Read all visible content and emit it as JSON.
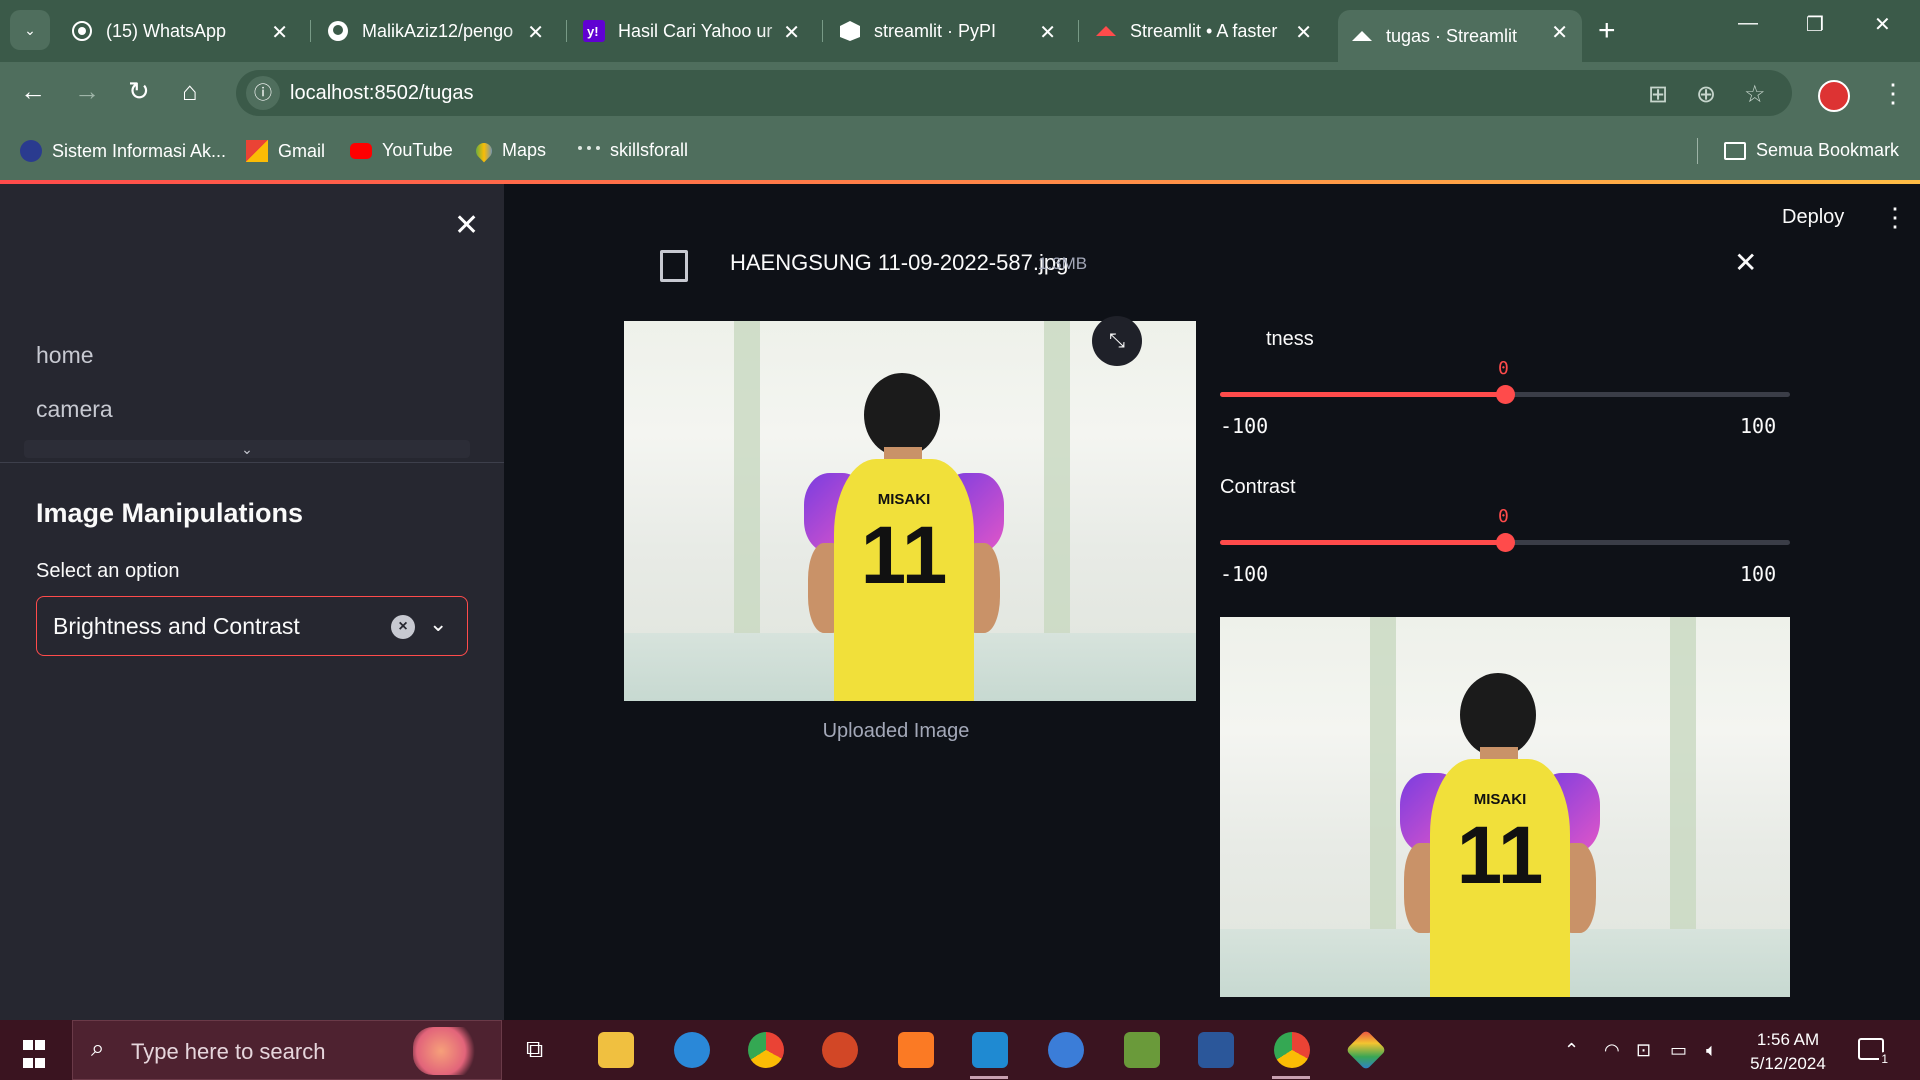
{
  "browser": {
    "tabs": [
      {
        "label": "(15) WhatsApp",
        "icon": "whatsapp-icon"
      },
      {
        "label": "MalikAziz12/pengo",
        "icon": "github-icon"
      },
      {
        "label": "Hasil Cari Yahoo ur",
        "icon": "yahoo-icon"
      },
      {
        "label": "streamlit · PyPI",
        "icon": "pypi-icon"
      },
      {
        "label": "Streamlit • A faster",
        "icon": "streamlit-icon"
      },
      {
        "label": "tugas · Streamlit",
        "icon": "streamlit-icon",
        "active": true
      }
    ],
    "url": "localhost:8502/tugas",
    "bookmarks": [
      {
        "label": "Sistem Informasi Ak...",
        "icon": "university-icon"
      },
      {
        "label": "Gmail",
        "icon": "gmail-icon"
      },
      {
        "label": "YouTube",
        "icon": "youtube-icon"
      },
      {
        "label": "Maps",
        "icon": "maps-icon"
      },
      {
        "label": "skillsforall",
        "icon": "cisco-icon"
      }
    ],
    "all_bookmarks_label": "Semua Bookmark"
  },
  "sidebar": {
    "nav": [
      "home",
      "camera"
    ],
    "section_title": "Image Manipulations",
    "select_label": "Select an option",
    "select_value": "Brightness and Contrast"
  },
  "main": {
    "deploy_label": "Deploy",
    "file": {
      "name": "HAENGSUNG 11-09-2022-587.jpg",
      "size": "1.3MB"
    },
    "original_caption": "Uploaded Image",
    "sliders": [
      {
        "label": "tness",
        "value": 0,
        "min": -100,
        "max": 100
      },
      {
        "label": "Contrast",
        "value": 0,
        "min": -100,
        "max": 100
      }
    ],
    "jersey": {
      "name": "MISAKI",
      "number": "11"
    }
  },
  "taskbar": {
    "search_placeholder": "Type here to search",
    "time": "1:56 AM",
    "date": "5/12/2024",
    "notification_count": "1"
  },
  "colors": {
    "accent": "#ff4b4b",
    "chrome": "#4f6e5d",
    "sidebar_bg": "#262730",
    "main_bg": "#0e1117",
    "taskbar": "#3a1420"
  }
}
